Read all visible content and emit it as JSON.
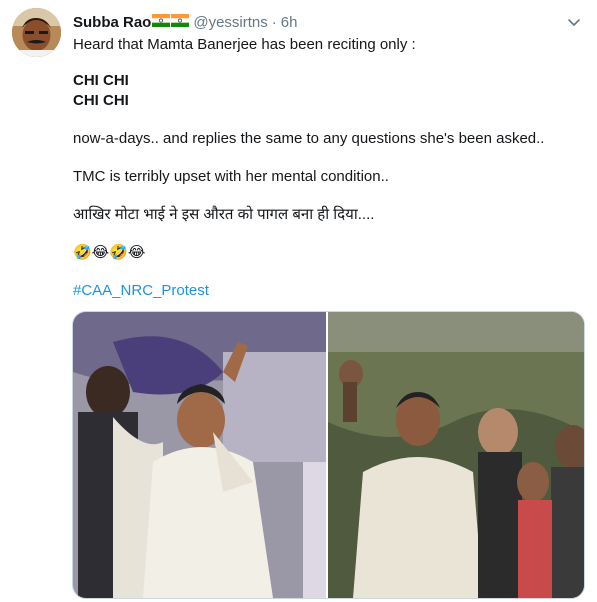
{
  "tweet": {
    "author_name": "Subba Rao",
    "handle": "@yessirtns",
    "separator": "·",
    "time": "6h",
    "lines": {
      "intro": "Heard that Mamta Banerjee has been reciting only :",
      "chant1": "CHI CHI",
      "chant2": "CHI CHI",
      "line3": "now-a-days.. and replies the same to any questions she's been asked..",
      "line4": "TMC is terribly upset with her mental condition..",
      "line5": "आखिर मोटा भाई ने इस औरत को पागल बना ही दिया....",
      "emojis": "🤣😂🤣😂",
      "hashtag": "#CAA_NRC_Protest"
    }
  },
  "icons": {
    "avatar": "avatar-image",
    "flags": [
      "india-flag-icon",
      "india-flag-icon"
    ],
    "caret": "chevron-down-icon"
  },
  "colors": {
    "link": "#1b95e0",
    "muted": "#657786",
    "text": "#14171a",
    "border": "#ccd6dd"
  }
}
